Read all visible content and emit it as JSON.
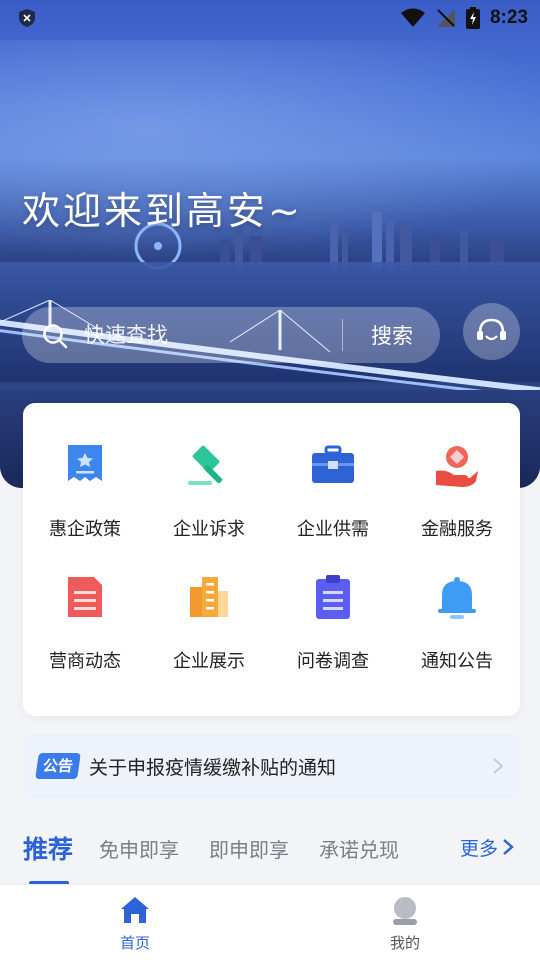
{
  "status_bar": {
    "time": "8:23"
  },
  "hero": {
    "welcome": "欢迎来到高安~"
  },
  "search": {
    "placeholder": "快速查找",
    "button": "搜索"
  },
  "grid": [
    {
      "label": "惠企政策",
      "icon": "policy-bookmark-icon"
    },
    {
      "label": "企业诉求",
      "icon": "gavel-icon"
    },
    {
      "label": "企业供需",
      "icon": "briefcase-icon"
    },
    {
      "label": "金融服务",
      "icon": "hand-coin-icon"
    },
    {
      "label": "营商动态",
      "icon": "document-icon"
    },
    {
      "label": "企业展示",
      "icon": "building-icon"
    },
    {
      "label": "问卷调查",
      "icon": "clipboard-icon"
    },
    {
      "label": "通知公告",
      "icon": "bell-icon"
    }
  ],
  "notice": {
    "badge": "公告",
    "text": "关于申报疫情缓缴补贴的通知"
  },
  "tabs": {
    "items": [
      "推荐",
      "免申即享",
      "即申即享",
      "承诺兑现"
    ],
    "more": "更多"
  },
  "bottom_nav": {
    "home": "首页",
    "mine": "我的"
  },
  "colors": {
    "accent": "#2d63d8",
    "notice_bg": "#eef3fb",
    "badge": "#3d7bea"
  }
}
